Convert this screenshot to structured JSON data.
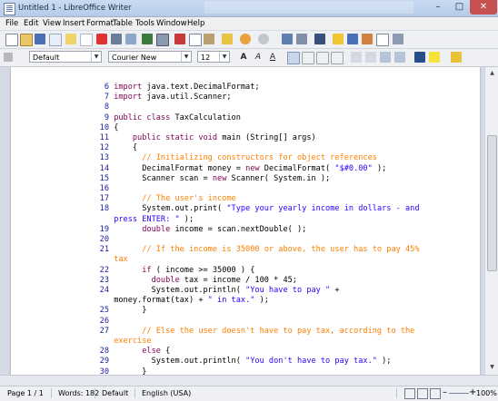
{
  "window": {
    "title": "Untitled 1 - LibreOffice Writer"
  },
  "menu": [
    "File",
    "Edit",
    "View",
    "Insert",
    "Format",
    "Table",
    "Tools",
    "Window",
    "Help"
  ],
  "formatting": {
    "style": "Default",
    "font": "Courier New",
    "size": "12"
  },
  "code_lines": [
    {
      "n": "6",
      "parts": [
        [
          "kw",
          "import "
        ],
        [
          "plain",
          "java.text.DecimalFormat;"
        ]
      ]
    },
    {
      "n": "7",
      "parts": [
        [
          "kw",
          "import "
        ],
        [
          "plain",
          "java.util.Scanner;"
        ]
      ]
    },
    {
      "n": "8",
      "parts": []
    },
    {
      "n": "9",
      "parts": [
        [
          "kw",
          "public class "
        ],
        [
          "plain",
          "TaxCalculation"
        ]
      ]
    },
    {
      "n": "10",
      "parts": [
        [
          "plain",
          "{"
        ]
      ]
    },
    {
      "n": "11",
      "parts": [
        [
          "kw",
          "    public static void "
        ],
        [
          "plain",
          "main (String[] args)"
        ]
      ]
    },
    {
      "n": "12",
      "parts": [
        [
          "plain",
          "    {"
        ]
      ]
    },
    {
      "n": "13",
      "parts": [
        [
          "cmt",
          "      // Initializing constructors for object references"
        ]
      ]
    },
    {
      "n": "14",
      "parts": [
        [
          "plain",
          "      DecimalFormat money = "
        ],
        [
          "kw",
          "new "
        ],
        [
          "plain",
          "DecimalFormat( "
        ],
        [
          "str",
          "\"$#0.00\""
        ],
        [
          "plain",
          " );"
        ]
      ]
    },
    {
      "n": "15",
      "parts": [
        [
          "plain",
          "      Scanner scan = "
        ],
        [
          "kw",
          "new "
        ],
        [
          "plain",
          "Scanner( System.in );"
        ]
      ]
    },
    {
      "n": "16",
      "parts": []
    },
    {
      "n": "17",
      "parts": [
        [
          "cmt",
          "      // The user's income"
        ]
      ]
    },
    {
      "n": "18",
      "parts": [
        [
          "plain",
          "      System.out.print( "
        ],
        [
          "str",
          "\"Type your yearly income in dollars - and"
        ]
      ]
    },
    {
      "n": "",
      "parts": [
        [
          "str",
          "press ENTER: \""
        ],
        [
          "plain",
          " );"
        ]
      ]
    },
    {
      "n": "19",
      "parts": [
        [
          "kw",
          "      double "
        ],
        [
          "plain",
          "income = scan.nextDouble( );"
        ]
      ]
    },
    {
      "n": "20",
      "parts": []
    },
    {
      "n": "21",
      "parts": [
        [
          "cmt",
          "      // If the income is 35000 or above, the user has to pay 45%"
        ]
      ]
    },
    {
      "n": "",
      "parts": [
        [
          "cmt",
          "tax"
        ]
      ]
    },
    {
      "n": "22",
      "parts": [
        [
          "kw",
          "      if "
        ],
        [
          "plain",
          "( income >= 35000 ) {"
        ]
      ]
    },
    {
      "n": "23",
      "parts": [
        [
          "kw",
          "        double "
        ],
        [
          "plain",
          "tax = income / 100 * 45;"
        ]
      ]
    },
    {
      "n": "24",
      "parts": [
        [
          "plain",
          "        System.out.println( "
        ],
        [
          "str",
          "\"You have to pay \""
        ],
        [
          "plain",
          " +"
        ]
      ]
    },
    {
      "n": "",
      "parts": [
        [
          "plain",
          "money.format(tax) + "
        ],
        [
          "str",
          "\" in tax.\""
        ],
        [
          "plain",
          " );"
        ]
      ]
    },
    {
      "n": "25",
      "parts": [
        [
          "plain",
          "      }"
        ]
      ]
    },
    {
      "n": "26",
      "parts": []
    },
    {
      "n": "27",
      "parts": [
        [
          "cmt",
          "      // Else the user doesn't have to pay tax, according to the"
        ]
      ]
    },
    {
      "n": "",
      "parts": [
        [
          "cmt",
          "exercise"
        ]
      ]
    },
    {
      "n": "28",
      "parts": [
        [
          "kw",
          "      else "
        ],
        [
          "plain",
          "{"
        ]
      ]
    },
    {
      "n": "29",
      "parts": [
        [
          "plain",
          "        System.out.println( "
        ],
        [
          "str",
          "\"You don't have to pay tax.\""
        ],
        [
          "plain",
          " );"
        ]
      ]
    },
    {
      "n": "30",
      "parts": [
        [
          "plain",
          "      }"
        ]
      ]
    }
  ],
  "status": {
    "page": "Page 1 / 1",
    "words": "Words: 182",
    "style": "Default",
    "language": "English (USA)",
    "zoom": "100%"
  }
}
